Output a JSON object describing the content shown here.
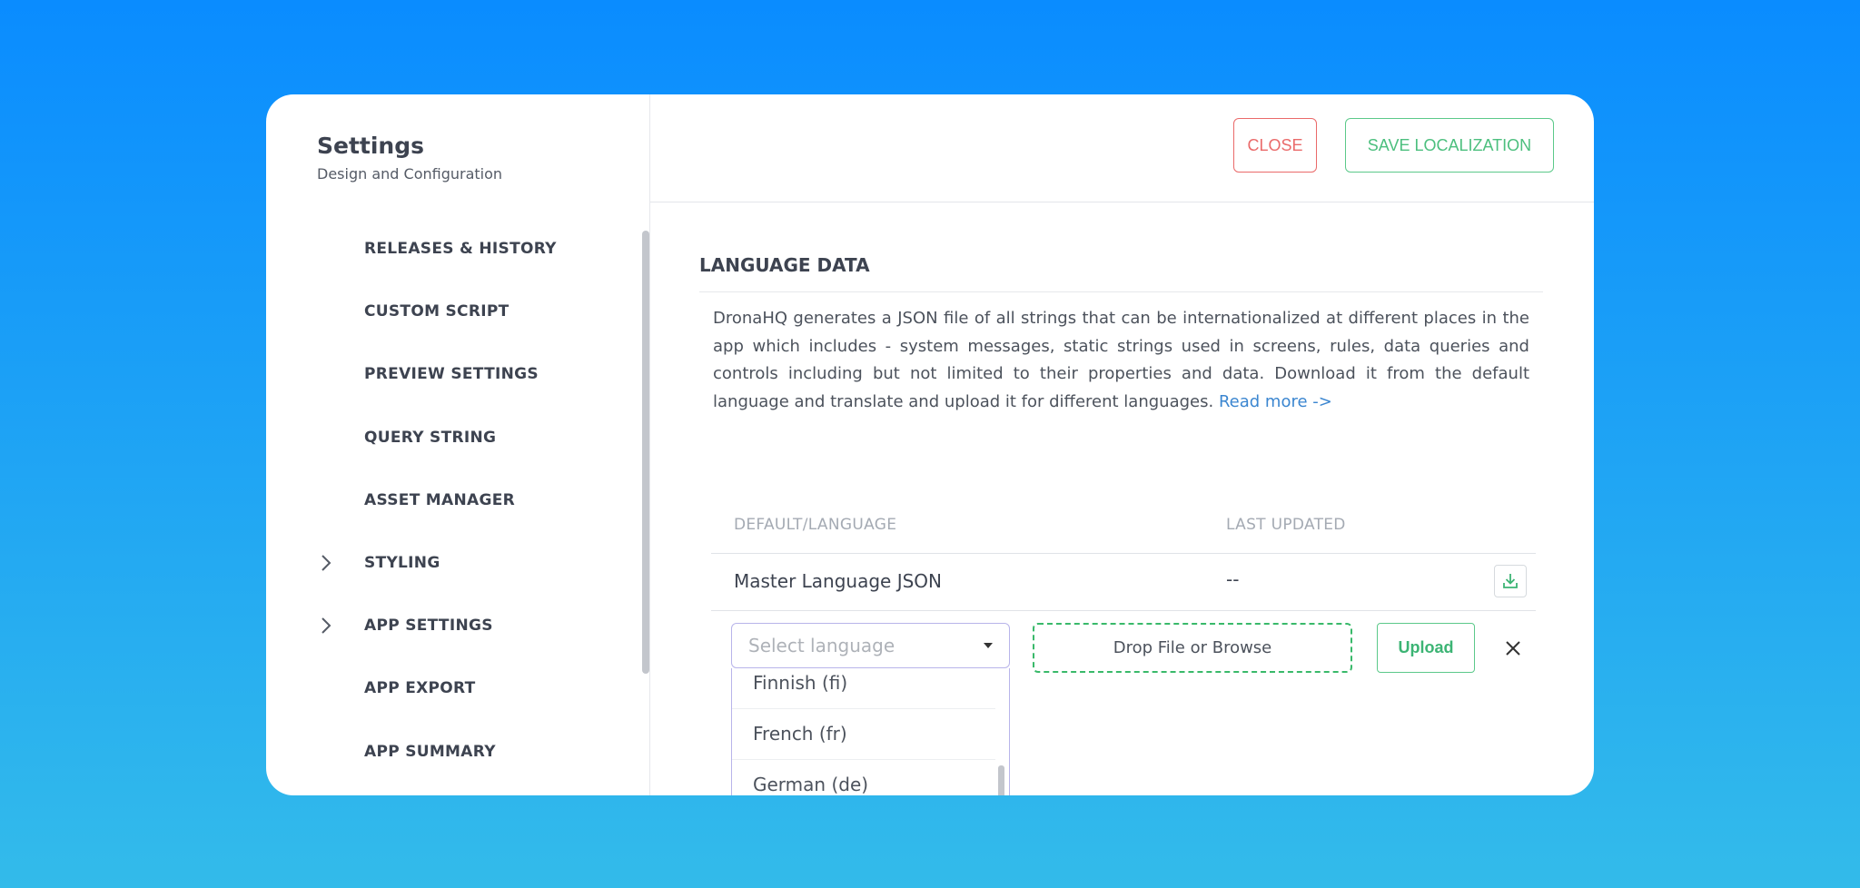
{
  "sidebar": {
    "title": "Settings",
    "subtitle": "Design and Configuration",
    "items": [
      {
        "label": "RELEASES & HISTORY",
        "expandable": false
      },
      {
        "label": "CUSTOM SCRIPT",
        "expandable": false
      },
      {
        "label": "PREVIEW SETTINGS",
        "expandable": false
      },
      {
        "label": "QUERY STRING",
        "expandable": false
      },
      {
        "label": "ASSET MANAGER",
        "expandable": false
      },
      {
        "label": "STYLING",
        "expandable": true,
        "icon": "chevron-right-icon"
      },
      {
        "label": "APP SETTINGS",
        "expandable": true,
        "icon": "chevron-right-icon"
      },
      {
        "label": "APP EXPORT",
        "expandable": false
      },
      {
        "label": "APP SUMMARY",
        "expandable": false
      }
    ]
  },
  "toolbar": {
    "close_label": "CLOSE",
    "save_label": "SAVE LOCALIZATION"
  },
  "section": {
    "title": "LANGUAGE DATA",
    "description": "DronaHQ generates a JSON file of all strings that can be internationalized at different places in the app which includes - system messages, static strings used in screens, rules, data queries and controls including but not limited to their properties and data. Download it from the default language and translate and upload it for different languages.",
    "read_more": "Read more ->"
  },
  "table": {
    "headers": {
      "language": "DEFAULT/LANGUAGE",
      "updated": "LAST UPDATED"
    },
    "rows": [
      {
        "name": "Master Language JSON",
        "updated": "--",
        "action_icon": "download-icon"
      }
    ]
  },
  "upload": {
    "select_placeholder": "Select language",
    "options": [
      "Finnish (fi)",
      "French (fr)",
      "German (de)"
    ],
    "drop_label": "Drop File or Browse",
    "upload_label": "Upload",
    "remove_icon": "close-icon"
  },
  "colors": {
    "background_top": "#0a8cff",
    "background_bottom": "#33bbea",
    "close": "#ea6a6a",
    "save": "#4cbf7e",
    "link": "#3b86d0",
    "select_border": "#b8b4ea"
  }
}
